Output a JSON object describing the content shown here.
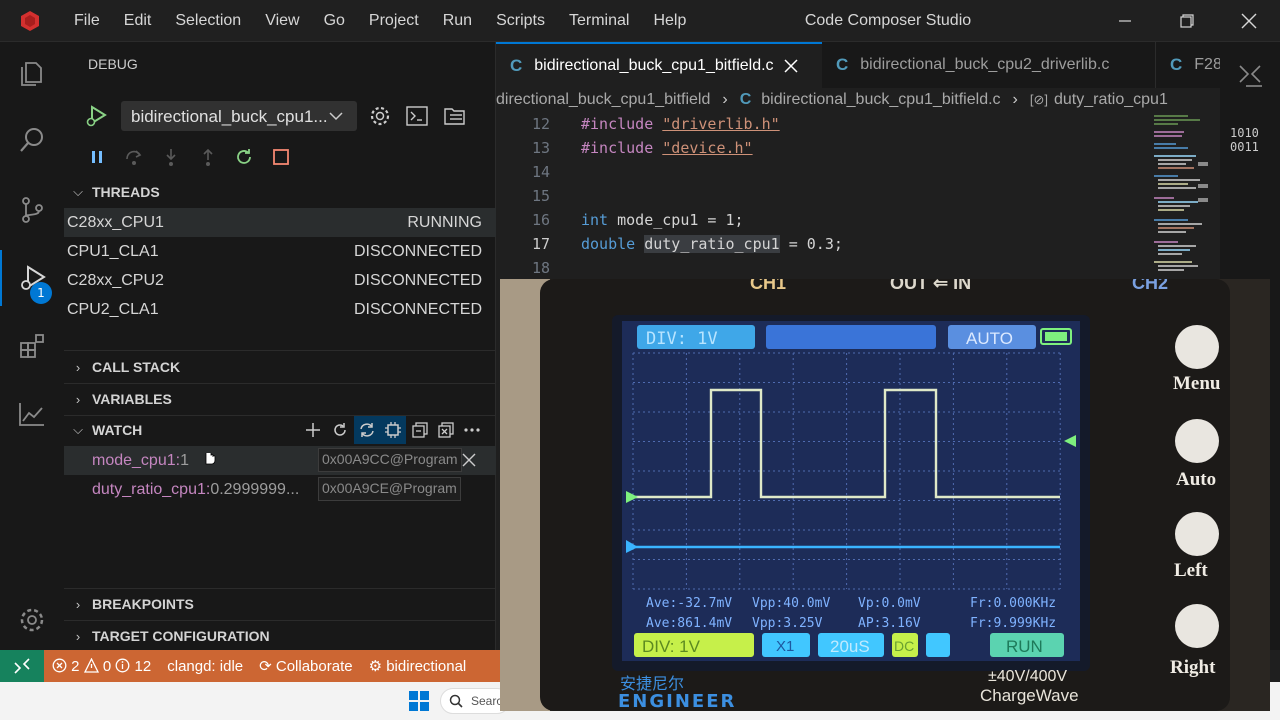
{
  "titlebar": {
    "menu": [
      "File",
      "Edit",
      "Selection",
      "View",
      "Go",
      "Project",
      "Run",
      "Scripts",
      "Terminal",
      "Help"
    ],
    "title": "Code Composer Studio"
  },
  "activity_bar": {
    "icons": [
      "files-icon",
      "search-icon",
      "source-control-icon",
      "run-debug-icon",
      "extensions-icon",
      "chart-icon",
      "settings-icon"
    ],
    "debug_badge": "1"
  },
  "sidebar": {
    "title": "DEBUG",
    "launch_config": "bidirectional_buck_cpu1...",
    "threads_header": "THREADS",
    "threads": [
      {
        "name": "C28xx_CPU1",
        "status": "RUNNING"
      },
      {
        "name": "CPU1_CLA1",
        "status": "DISCONNECTED"
      },
      {
        "name": "C28xx_CPU2",
        "status": "DISCONNECTED"
      },
      {
        "name": "CPU2_CLA1",
        "status": "DISCONNECTED"
      }
    ],
    "call_stack_header": "CALL STACK",
    "variables_header": "VARIABLES",
    "watch_header": "WATCH",
    "watch": [
      {
        "name": "mode_cpu1:",
        "value": " 1",
        "address": "0x00A9CC@Program"
      },
      {
        "name": "duty_ratio_cpu1:",
        "value": " 0.2999999...",
        "address": "0x00A9CE@Program"
      }
    ],
    "breakpoints_header": "BREAKPOINTS",
    "target_config_header": "TARGET CONFIGURATION"
  },
  "editor": {
    "tabs": [
      {
        "label": "bidirectional_buck_cpu1_bitfield.c",
        "active": true
      },
      {
        "label": "bidirectional_buck_cpu2_driverlib.c",
        "active": false
      },
      {
        "label": "F28",
        "active": false
      }
    ],
    "breadcrumb": {
      "folder": "directional_buck_cpu1_bitfield",
      "file": "bidirectional_buck_cpu1_bitfield.c",
      "symbol": "duty_ratio_cpu1"
    },
    "lines": [
      {
        "num": "12",
        "directive": "#include",
        "str": "\"driverlib.h\""
      },
      {
        "num": "13",
        "directive": "#include",
        "str": "\"device.h\""
      },
      {
        "num": "14"
      },
      {
        "num": "15"
      },
      {
        "num": "16",
        "type": "int",
        "rest": " mode_cpu1 = 1;"
      },
      {
        "num": "17",
        "type": "double",
        "var": "duty_ratio_cpu1",
        "rest": " = 0.3;"
      },
      {
        "num": "18"
      }
    ],
    "right_icon_text": [
      "1010",
      "0011"
    ]
  },
  "statusbar": {
    "errors": "2",
    "warnings": "0",
    "infos": "12",
    "clangd": "clangd: idle",
    "collaborate": "Collaborate",
    "project": "bidirectional"
  },
  "taskbar": {
    "search_placeholder": "Search"
  },
  "oscilloscope": {
    "top_labels": {
      "ch1": "CH1",
      "out_in": "OUT ⇐ IN",
      "ch2": "CH2"
    },
    "div": "DIV:    1V",
    "mode": "AUTO",
    "stats": {
      "ave1": "Ave:-32.7mV",
      "vpp1": "Vpp:40.0mV",
      "vp1": "Vp:0.0mV",
      "fr1": "Fr:0.000KHz",
      "ave2": "Ave:861.4mV",
      "vpp2": "Vpp:3.25V",
      "ap": "AP:3.16V",
      "fr2": "Fr:9.999KHz"
    },
    "bottom": {
      "div": "DIV:   1V",
      "x1": "X1",
      "time": "20uS",
      "dc": "DC",
      "run": "RUN"
    },
    "buttons": [
      "Menu",
      "Auto",
      "Left",
      "Right"
    ],
    "spec": "±40V/400V",
    "brand": "ChargeWave",
    "logo_cn": "安捷尼尔",
    "logo_en": "ENGINEER"
  }
}
